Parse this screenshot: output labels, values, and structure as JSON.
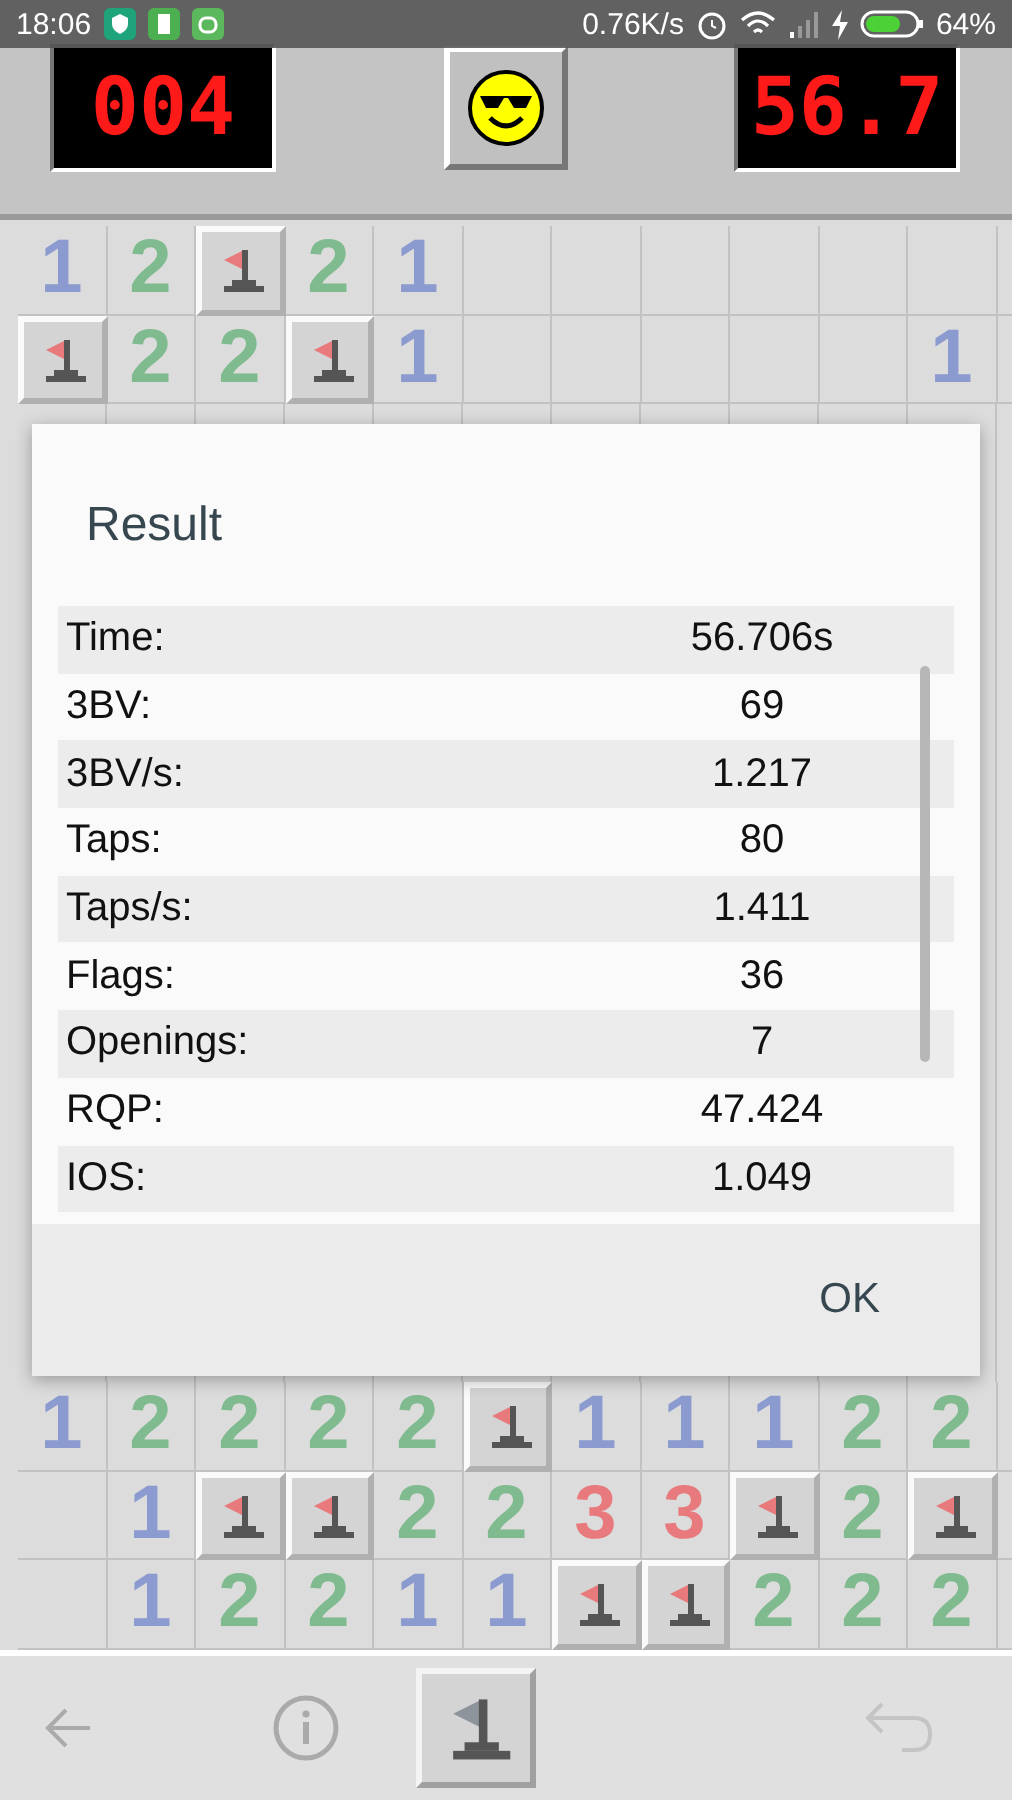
{
  "status_bar": {
    "time": "18:06",
    "network_speed": "0.76K/s",
    "battery_percent": "64%"
  },
  "header": {
    "mine_counter": "004",
    "timer": "56.7"
  },
  "board": {
    "top_rows": [
      [
        {
          "kind": "number",
          "text": "1",
          "color": "#8c9bcf"
        },
        {
          "kind": "number",
          "text": "2",
          "color": "#7fbb8e"
        },
        {
          "kind": "flag"
        },
        {
          "kind": "number",
          "text": "2",
          "color": "#7fbb8e"
        },
        {
          "kind": "number",
          "text": "1",
          "color": "#8c9bcf"
        },
        {
          "kind": "empty"
        },
        {
          "kind": "empty"
        },
        {
          "kind": "empty"
        },
        {
          "kind": "empty"
        },
        {
          "kind": "empty"
        },
        {
          "kind": "empty"
        }
      ],
      [
        {
          "kind": "flag"
        },
        {
          "kind": "number",
          "text": "2",
          "color": "#7fbb8e"
        },
        {
          "kind": "number",
          "text": "2",
          "color": "#7fbb8e"
        },
        {
          "kind": "flag"
        },
        {
          "kind": "number",
          "text": "1",
          "color": "#8c9bcf"
        },
        {
          "kind": "empty"
        },
        {
          "kind": "empty"
        },
        {
          "kind": "empty"
        },
        {
          "kind": "empty"
        },
        {
          "kind": "empty"
        },
        {
          "kind": "number",
          "text": "1",
          "color": "#8c9bcf"
        }
      ]
    ],
    "bottom_rows": [
      [
        {
          "kind": "number",
          "text": "1",
          "color": "#8c9bcf"
        },
        {
          "kind": "number",
          "text": "2",
          "color": "#7fbb8e"
        },
        {
          "kind": "number",
          "text": "2",
          "color": "#7fbb8e"
        },
        {
          "kind": "number",
          "text": "2",
          "color": "#7fbb8e"
        },
        {
          "kind": "number",
          "text": "2",
          "color": "#7fbb8e"
        },
        {
          "kind": "flag"
        },
        {
          "kind": "number",
          "text": "1",
          "color": "#8c9bcf"
        },
        {
          "kind": "number",
          "text": "1",
          "color": "#8c9bcf"
        },
        {
          "kind": "number",
          "text": "1",
          "color": "#8c9bcf"
        },
        {
          "kind": "number",
          "text": "2",
          "color": "#7fbb8e"
        },
        {
          "kind": "number",
          "text": "2",
          "color": "#7fbb8e"
        }
      ],
      [
        {
          "kind": "empty"
        },
        {
          "kind": "number",
          "text": "1",
          "color": "#8c9bcf"
        },
        {
          "kind": "flag"
        },
        {
          "kind": "flag"
        },
        {
          "kind": "number",
          "text": "2",
          "color": "#7fbb8e"
        },
        {
          "kind": "number",
          "text": "2",
          "color": "#7fbb8e"
        },
        {
          "kind": "number",
          "text": "3",
          "color": "#e8797c"
        },
        {
          "kind": "number",
          "text": "3",
          "color": "#e8797c"
        },
        {
          "kind": "flag"
        },
        {
          "kind": "number",
          "text": "2",
          "color": "#7fbb8e"
        },
        {
          "kind": "flag"
        }
      ],
      [
        {
          "kind": "empty"
        },
        {
          "kind": "number",
          "text": "1",
          "color": "#8c9bcf"
        },
        {
          "kind": "number",
          "text": "2",
          "color": "#7fbb8e"
        },
        {
          "kind": "number",
          "text": "2",
          "color": "#7fbb8e"
        },
        {
          "kind": "number",
          "text": "1",
          "color": "#8c9bcf"
        },
        {
          "kind": "number",
          "text": "1",
          "color": "#8c9bcf"
        },
        {
          "kind": "flag"
        },
        {
          "kind": "flag"
        },
        {
          "kind": "number",
          "text": "2",
          "color": "#7fbb8e"
        },
        {
          "kind": "number",
          "text": "2",
          "color": "#7fbb8e"
        },
        {
          "kind": "number",
          "text": "2",
          "color": "#7fbb8e"
        }
      ]
    ]
  },
  "dialog": {
    "title": "Result",
    "rows": [
      {
        "label": "Time:",
        "value": "56.706s"
      },
      {
        "label": "3BV:",
        "value": "69"
      },
      {
        "label": "3BV/s:",
        "value": "1.217"
      },
      {
        "label": "Taps:",
        "value": "80"
      },
      {
        "label": "Taps/s:",
        "value": "1.411"
      },
      {
        "label": "Flags:",
        "value": "36"
      },
      {
        "label": "Openings:",
        "value": "7"
      },
      {
        "label": "RQP:",
        "value": "47.424"
      },
      {
        "label": "IOS:",
        "value": "1.049"
      }
    ],
    "ok_button": "OK"
  }
}
